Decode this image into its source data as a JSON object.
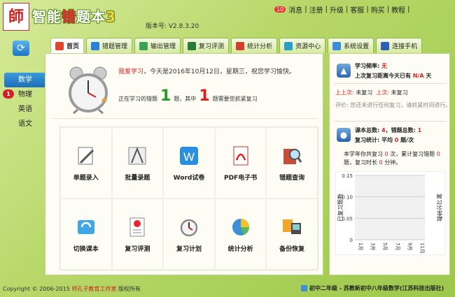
{
  "app": {
    "logo_text": "師",
    "title_main": "智能",
    "title_em": "错",
    "title_rest": "题本",
    "title_num": "3",
    "version": "版本号: V2.8.3.20"
  },
  "toplinks": {
    "msg_count": "10",
    "msg": "消息",
    "register": "注册",
    "upgrade": "升级",
    "service": "客服",
    "buy": "购买",
    "tutorial": "教程",
    "sep": "|"
  },
  "tabs": [
    {
      "label": "首页",
      "icon": "home-icon",
      "color": "#e0452b"
    },
    {
      "label": "错题管理",
      "icon": "edit-icon",
      "color": "#2b7fd6"
    },
    {
      "label": "输出管理",
      "icon": "output-icon",
      "color": "#3aa255"
    },
    {
      "label": "复习评测",
      "icon": "board-icon",
      "color": "#2a7a3a"
    },
    {
      "label": "统计分析",
      "icon": "chart-icon",
      "color": "#d2402a"
    },
    {
      "label": "资源中心",
      "icon": "resource-icon",
      "color": "#2aa0c6"
    },
    {
      "label": "系统设置",
      "icon": "settings-icon",
      "color": "#3c8ad8"
    },
    {
      "label": "连接手机",
      "icon": "phone-icon",
      "color": "#2f5fb3"
    }
  ],
  "subjects": [
    {
      "label": "数学",
      "active": true
    },
    {
      "label": "物理",
      "badge": "1"
    },
    {
      "label": "英语"
    },
    {
      "label": "语文"
    }
  ],
  "greeting": {
    "user": "我爱学习",
    "text": "，今天是2016年10月12日，星期三，祝您学习愉快。"
  },
  "learning": {
    "prefix": "正在学习的错题",
    "count": "1",
    "mid": "题，其中",
    "urgent": "1",
    "suffix": "题需要您抓紧复习"
  },
  "functions": [
    {
      "label": "单题录入",
      "icon": "single-entry-icon"
    },
    {
      "label": "批量录题",
      "icon": "batch-entry-icon"
    },
    {
      "label": "Word试卷",
      "icon": "word-icon"
    },
    {
      "label": "PDF电子书",
      "icon": "pdf-icon"
    },
    {
      "label": "错题查询",
      "icon": "search-book-icon"
    },
    {
      "label": "切换课本",
      "icon": "switch-book-icon"
    },
    {
      "label": "复习评测",
      "icon": "review-test-icon"
    },
    {
      "label": "复习计划",
      "icon": "plan-clock-icon"
    },
    {
      "label": "统计分析",
      "icon": "pie-chart-icon"
    },
    {
      "label": "备份恢复",
      "icon": "backup-icon"
    }
  ],
  "review": {
    "freq_label": "学习频率:",
    "freq_value": "无",
    "last_label": "上次复习距离今天已有",
    "last_value": "N/A",
    "last_unit": "天",
    "prev1_label": "上上次:",
    "prev1_value": "未复习",
    "prev2_label": "上次:",
    "prev2_value": "未复习",
    "eval": "评价: 您还未进行任何复习，请抓紧时间进行。"
  },
  "stats": {
    "total_label": "课本总数:",
    "total": "4",
    "wrong_label": "错题总数:",
    "wrong": "1",
    "review_label": "复习统计:",
    "avg": "平均",
    "avg_value": "0",
    "avg_unit": "题/次",
    "summary1": "本学年你共复习",
    "s_count": "0",
    "summary2": "次，累计复习错题",
    "s_wrong": "0",
    "summary3": "题，复习时长",
    "s_time": "0",
    "summary4": "分钟。"
  },
  "chart_data": {
    "type": "line",
    "categories": [
      "1月",
      "3月",
      "5月",
      "7月",
      "9月",
      "11月"
    ],
    "series": [
      {
        "values": [
          0,
          0,
          0,
          0,
          0,
          0
        ]
      }
    ],
    "ylabel": "已复习题数",
    "y2label": "复习分钟数",
    "ylim": [
      0,
      0.15
    ],
    "yticks": [
      "0.15",
      "0.10",
      "0.05",
      "0"
    ],
    "grid": true
  },
  "footer": {
    "copy": "Copyright © 2006-2015",
    "studio": "师孔子教育工作室",
    "rights": "版权所有",
    "book": "初中二年级 - 苏教新初中八年级数学(江苏科技出版社)"
  }
}
